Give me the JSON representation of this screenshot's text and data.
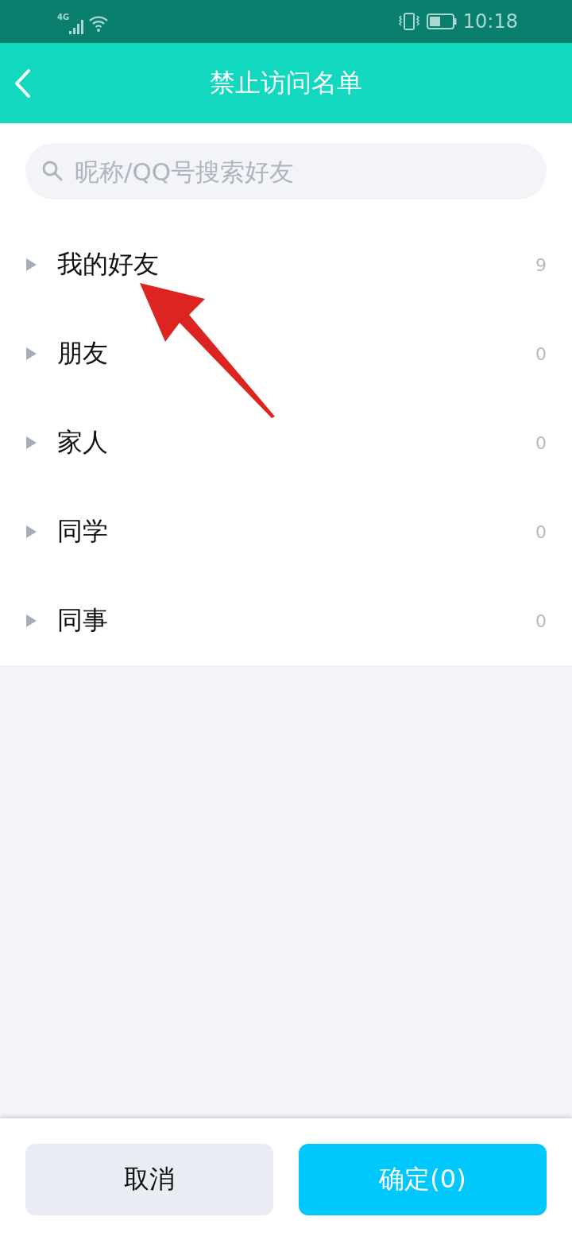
{
  "status_bar": {
    "network": "4G",
    "time": "10:18"
  },
  "header": {
    "title": "禁止访问名单"
  },
  "search": {
    "placeholder": "昵称/QQ号搜索好友"
  },
  "groups": [
    {
      "name": "我的好友",
      "count": "9",
      "expanded": false
    },
    {
      "name": "朋友",
      "count": "0",
      "expanded": false
    },
    {
      "name": "家人",
      "count": "0",
      "expanded": false
    },
    {
      "name": "同学",
      "count": "0",
      "expanded": false
    },
    {
      "name": "同事",
      "count": "0",
      "expanded": false
    }
  ],
  "buttons": {
    "cancel": "取消",
    "confirm": "确定(0)"
  }
}
